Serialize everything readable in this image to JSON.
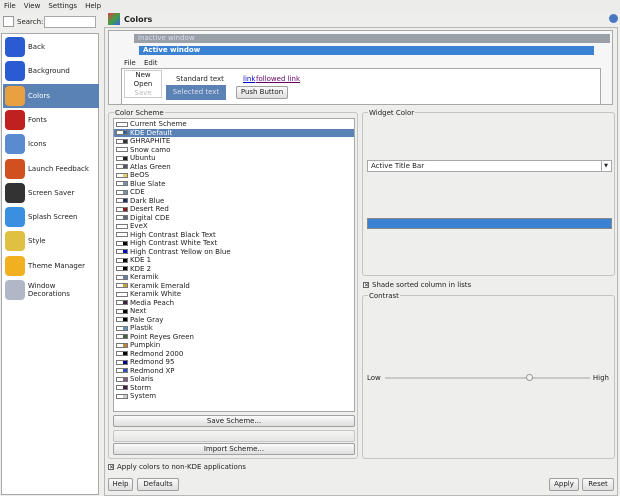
{
  "menu": [
    "File",
    "View",
    "Settings",
    "Help"
  ],
  "search": {
    "label": "Search:",
    "value": ""
  },
  "sidebar": [
    {
      "label": "Back",
      "color": "#2a5bd0"
    },
    {
      "label": "Background",
      "color": "#2a5bd0"
    },
    {
      "label": "Colors",
      "color": "#e8a040",
      "selected": true
    },
    {
      "label": "Fonts",
      "color": "#c02020"
    },
    {
      "label": "Icons",
      "color": "#5a8ad0"
    },
    {
      "label": "Launch Feedback",
      "color": "#d05020"
    },
    {
      "label": "Screen Saver",
      "color": "#333333"
    },
    {
      "label": "Splash Screen",
      "color": "#3a90e0"
    },
    {
      "label": "Style",
      "color": "#e0c040"
    },
    {
      "label": "Theme Manager",
      "color": "#f0b020"
    },
    {
      "label": "Window Decorations",
      "color": "#b0b8c8"
    }
  ],
  "header": {
    "title": "Colors"
  },
  "preview": {
    "inactive": "Inactive window",
    "active": "Active window",
    "menu": [
      "File",
      "Edit"
    ],
    "popup": [
      "New",
      "Open",
      "Save"
    ],
    "standard": "Standard text",
    "selected": "Selected text",
    "link": "link",
    "followed": "followed link",
    "push": "Push Button"
  },
  "scheme": {
    "title": "Color Scheme",
    "selected_index": 1,
    "items": [
      {
        "name": "Current Scheme",
        "c": "#ffffff"
      },
      {
        "name": "KDE Default",
        "c": "#3060a0"
      },
      {
        "name": "GHRAPHITE",
        "c": "#333"
      },
      {
        "name": "Snow camo",
        "c": "#fff"
      },
      {
        "name": "Ubuntu",
        "c": "#222"
      },
      {
        "name": "Atlas Green",
        "c": "#556"
      },
      {
        "name": "BeOS",
        "c": "#e8d070"
      },
      {
        "name": "Blue Slate",
        "c": "#7890a8"
      },
      {
        "name": "CDE",
        "c": "#7890a0"
      },
      {
        "name": "Dark Blue",
        "c": "#203060"
      },
      {
        "name": "Desert Red",
        "c": "#802020"
      },
      {
        "name": "Digital CDE",
        "c": "#606878"
      },
      {
        "name": "EveX",
        "c": "#fff"
      },
      {
        "name": "High Contrast Black Text",
        "c": "#fff"
      },
      {
        "name": "High Contrast White Text",
        "c": "#000"
      },
      {
        "name": "High Contrast Yellow on Blue",
        "c": "#0000c0"
      },
      {
        "name": "KDE 1",
        "c": "#000"
      },
      {
        "name": "KDE 2",
        "c": "#000"
      },
      {
        "name": "Keramik",
        "c": "#6080a0"
      },
      {
        "name": "Keramik Emerald",
        "c": "#c0a040"
      },
      {
        "name": "Keramik White",
        "c": "#fff"
      },
      {
        "name": "Media Peach",
        "c": "#402040"
      },
      {
        "name": "Next",
        "c": "#000"
      },
      {
        "name": "Pale Gray",
        "c": "#000"
      },
      {
        "name": "Plastik",
        "c": "#6090c0"
      },
      {
        "name": "Point Reyes Green",
        "c": "#406040"
      },
      {
        "name": "Pumpkin",
        "c": "#c08040"
      },
      {
        "name": "Redmond 2000",
        "c": "#000"
      },
      {
        "name": "Redmond 95",
        "c": "#000080"
      },
      {
        "name": "Redmond XP",
        "c": "#3050c0"
      },
      {
        "name": "Solaris",
        "c": "#806080"
      },
      {
        "name": "Storm",
        "c": "#402040"
      },
      {
        "name": "System",
        "c": "#ccc"
      }
    ],
    "save": "Save Scheme...",
    "import": "Import Scheme..."
  },
  "widget": {
    "title": "Widget Color",
    "value": "Active Title Bar",
    "color": "#3c82d4"
  },
  "shade": {
    "label": "Shade sorted column in lists",
    "checked": true
  },
  "contrast": {
    "title": "Contrast",
    "low": "Low",
    "high": "High",
    "value": 0.7
  },
  "apply_non_kde": {
    "label": "Apply colors to non-KDE applications",
    "checked": true
  },
  "buttons": {
    "help": "Help",
    "defaults": "Defaults",
    "apply": "Apply",
    "reset": "Reset"
  }
}
